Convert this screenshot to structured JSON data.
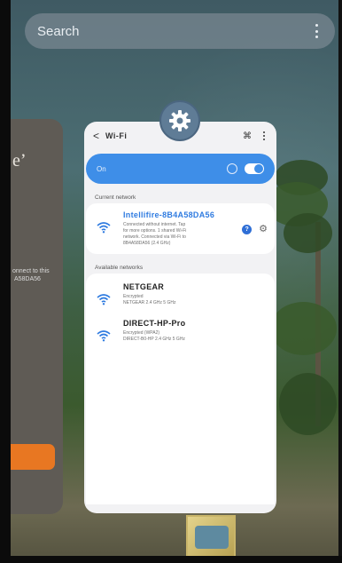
{
  "search": {
    "label": "Search"
  },
  "left_card": {
    "big_text": "eʼ",
    "small_text_line1": "onnect to this",
    "small_text_line2": " A58DA56"
  },
  "wifi_card": {
    "header": {
      "back": "<",
      "title": "Wi-Fi",
      "scan_icon": "⌘"
    },
    "toggle": {
      "label": "On",
      "state": "on"
    },
    "current_network_label": "Current network",
    "current": {
      "name": "Intellifire-8B4A58DA56",
      "detail_line1": "Connected without internet. Tap",
      "detail_line2": "for more options. 1 shared Wi-Fi",
      "detail_line3": "network. Connected via Wi-Fi to",
      "detail_line4": "8B4A58DA56 (2.4 GHz)"
    },
    "available_networks_label": "Available networks",
    "available": [
      {
        "name": "NETGEAR",
        "detail_line1": "Encrypted",
        "detail_line2": "NETGEAR 2.4 GHz 5 GHz"
      },
      {
        "name": "DIRECT-HP-Pro",
        "detail_line1": "Encrypted (WPA2)",
        "detail_line2": "DIRECT-B0-HP 2.4 GHz 5 GHz"
      }
    ]
  },
  "colors": {
    "accent": "#3e8ee8",
    "orange": "#e87722",
    "connected_text": "#2f7be0"
  },
  "icons": {
    "settings_badge": "gear-icon",
    "menu": "more-vert-icon",
    "wifi": "wifi-icon"
  }
}
